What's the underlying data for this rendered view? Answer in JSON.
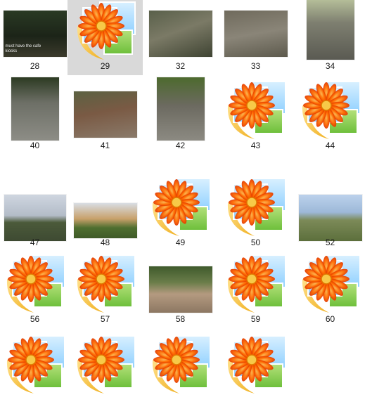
{
  "window": {
    "title": ""
  },
  "files": [
    {
      "label": "28",
      "kind": "photo",
      "tint": "forest-dark",
      "caption": "must have the cafe kiosks"
    },
    {
      "label": "29",
      "kind": "placeholder",
      "state": "hover"
    },
    {
      "label": "32",
      "kind": "photo",
      "tint": "rocky-stream"
    },
    {
      "label": "33",
      "kind": "photo",
      "tint": "stone-path"
    },
    {
      "label": "34",
      "kind": "photo",
      "tint": "stone-wall"
    },
    {
      "label": "40",
      "kind": "photo",
      "tint": "cobble-path"
    },
    {
      "label": "41",
      "kind": "photo",
      "tint": "brick-pile"
    },
    {
      "label": "42",
      "kind": "photo",
      "tint": "cobble-bench"
    },
    {
      "label": "43",
      "kind": "placeholder"
    },
    {
      "label": "44",
      "kind": "placeholder"
    },
    {
      "label": "47",
      "kind": "photo",
      "tint": "country-road"
    },
    {
      "label": "48",
      "kind": "photo",
      "tint": "bonfire"
    },
    {
      "label": "49",
      "kind": "placeholder"
    },
    {
      "label": "50",
      "kind": "placeholder"
    },
    {
      "label": "52",
      "kind": "photo",
      "tint": "pond-field"
    },
    {
      "label": "56",
      "kind": "placeholder"
    },
    {
      "label": "57",
      "kind": "placeholder"
    },
    {
      "label": "58",
      "kind": "photo",
      "tint": "gravel-plot"
    },
    {
      "label": "59",
      "kind": "placeholder"
    },
    {
      "label": "60",
      "kind": "placeholder"
    },
    {
      "label": "",
      "kind": "placeholder"
    },
    {
      "label": "",
      "kind": "placeholder"
    },
    {
      "label": "",
      "kind": "placeholder"
    },
    {
      "label": "",
      "kind": "placeholder"
    }
  ]
}
